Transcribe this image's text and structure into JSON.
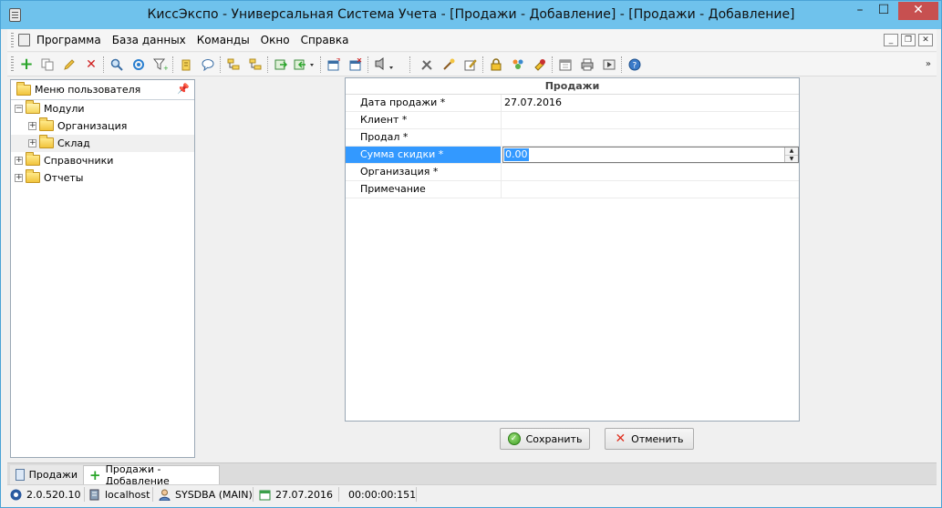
{
  "window": {
    "title": "КиссЭкспо - Универсальная Система Учета - [Продажи - Добавление] - [Продажи - Добавление]",
    "minimize_label": "–",
    "maximize_label": "☐",
    "close_label": "✕"
  },
  "menu": {
    "items": [
      "Программа",
      "База данных",
      "Команды",
      "Окно",
      "Справка"
    ],
    "mdi_minimize": "_",
    "mdi_restore": "❐",
    "mdi_close": "✕"
  },
  "toolbar": {
    "icons": [
      "add-icon",
      "copy-icon",
      "edit-icon",
      "delete-icon",
      "search-icon",
      "refresh-icon",
      "filter-icon",
      "sort-icon",
      "comment-icon",
      "tree-expand-icon",
      "tree-collapse-icon",
      "export-icon",
      "import-icon",
      "new-window-icon",
      "close-window-icon",
      "print-preview-icon",
      "tools-icon",
      "wizard-icon",
      "edit-form-icon",
      "lock-icon",
      "users-icon",
      "settings-icon",
      "calendar-icon",
      "printer-icon",
      "play-icon",
      "help-icon"
    ],
    "overflow_label": "»"
  },
  "user_menu": {
    "title": "Меню пользователя",
    "items": [
      {
        "label": "Модули",
        "level": 0,
        "expanded": true
      },
      {
        "label": "Организация",
        "level": 1,
        "expanded": false
      },
      {
        "label": "Склад",
        "level": 1,
        "expanded": false,
        "selected": true
      },
      {
        "label": "Справочники",
        "level": 0,
        "expanded": false
      },
      {
        "label": "Отчеты",
        "level": 0,
        "expanded": false
      }
    ]
  },
  "form": {
    "title": "Продажи",
    "rows": [
      {
        "label": "Дата продажи *",
        "value": "27.07.2016"
      },
      {
        "label": "Клиент *",
        "value": ""
      },
      {
        "label": "Продал *",
        "value": ""
      },
      {
        "label": "Сумма скидки *",
        "value": "0.00",
        "active": true
      },
      {
        "label": "Организация *",
        "value": ""
      },
      {
        "label": "Примечание",
        "value": ""
      }
    ],
    "save_label": "Сохранить",
    "cancel_label": "Отменить"
  },
  "tabs": [
    {
      "label": "Продажи",
      "active": false
    },
    {
      "label": "Продажи - Добавление",
      "active": true
    }
  ],
  "status": {
    "version": "2.0.520.10",
    "host": "localhost",
    "user": "SYSDBA (MAIN)",
    "date": "27.07.2016",
    "timer": "00:00:00:151"
  }
}
